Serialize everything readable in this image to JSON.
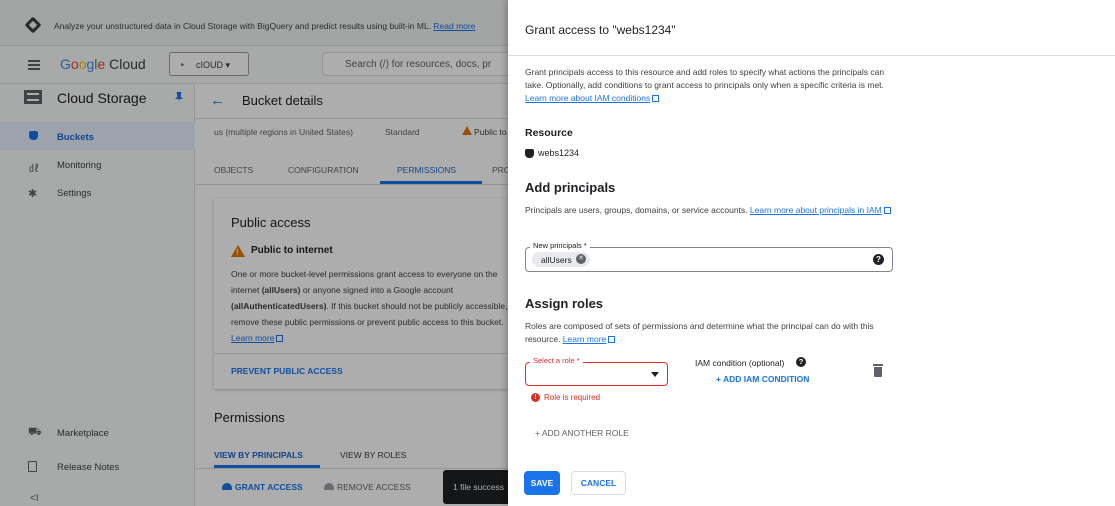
{
  "banner": {
    "text": "Analyze your unstructured data in Cloud Storage with BigQuery and predict results using built-in ML.",
    "link": "Read more"
  },
  "topbar": {
    "logo_google": [
      "G",
      "o",
      "o",
      "g",
      "l",
      "e"
    ],
    "logo_cloud": "Cloud",
    "project_name": "cIOUD",
    "search_placeholder": "Search (/) for resources, docs, pr"
  },
  "sidebar": {
    "title": "Cloud Storage",
    "items": [
      {
        "label": "Buckets"
      },
      {
        "label": "Monitoring"
      },
      {
        "label": "Settings"
      }
    ],
    "bottom_items": [
      {
        "label": "Marketplace"
      },
      {
        "label": "Release Notes"
      }
    ],
    "collapse_glyph": "<I"
  },
  "main": {
    "title": "Bucket details",
    "location": "us (multiple regions in United States)",
    "storage_class": "Standard",
    "public_badge": "Public to",
    "tabs": [
      "OBJECTS",
      "CONFIGURATION",
      "PERMISSIONS",
      "PRO"
    ],
    "public_access": {
      "title": "Public access",
      "subtitle": "Public to internet",
      "body_1": "One or more bucket-level permissions grant access to everyone on the internet ",
      "body_allusers": "(allUsers)",
      "body_2": " or anyone signed into a Google account ",
      "body_allauth": "(allAuthenticatedUsers)",
      "body_3": ". If this bucket should not be publicly accessible, remove these public permissions or prevent public access to this bucket. ",
      "learn_more": "Learn more",
      "prevent_button": "PREVENT PUBLIC ACCESS"
    },
    "permissions": {
      "title": "Permissions",
      "view_principals": "VIEW BY PRINCIPALS",
      "view_roles": "VIEW BY ROLES",
      "grant_access": "GRANT ACCESS",
      "remove_access": "REMOVE ACCESS"
    },
    "toast": "1 file success"
  },
  "panel": {
    "title": "Grant access to \"webs1234\"",
    "intro": "Grant principals access to this resource and add roles to specify what actions the principals can take. Optionally, add conditions to grant access to principals only when a specific criteria is met. ",
    "intro_link": "Learn more about IAM conditions",
    "resource_heading": "Resource",
    "resource_name": "webs1234",
    "add_principals_heading": "Add principals",
    "add_principals_desc": "Principals are users, groups, domains, or service accounts. ",
    "add_principals_link": "Learn more about principals in IAM",
    "new_principals_label": "New principals *",
    "principal_chip": "allUsers",
    "assign_roles_heading": "Assign roles",
    "assign_roles_desc": "Roles are composed of sets of permissions and determine what the principal can do with this resource. ",
    "assign_roles_link": "Learn more",
    "select_role_label": "Select a role *",
    "role_error": "Role is required",
    "iam_condition_label": "IAM condition (optional)",
    "add_iam_condition": "+ ADD IAM CONDITION",
    "add_another_role": "+ ADD ANOTHER ROLE",
    "save": "SAVE",
    "cancel": "CANCEL"
  },
  "colors": {
    "accent": "#1a73e8",
    "error": "#d93025",
    "warning": "#e37400"
  }
}
